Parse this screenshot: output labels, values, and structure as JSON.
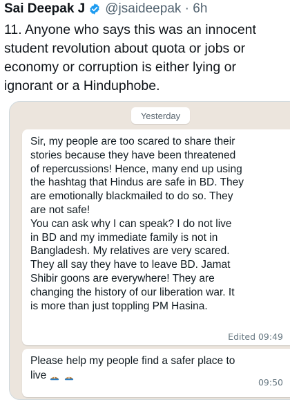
{
  "tweet": {
    "author_name": "Sai Deepak J",
    "handle_and_time": "@jsaideepak · 6h",
    "text_lines": [
      "11. Anyone who says this was an innocent",
      "student revolution about quota or jobs or",
      "economy or corruption is either lying or",
      "ignorant or a Hinduphobe."
    ]
  },
  "chat": {
    "date_chip": "Yesterday",
    "messages": [
      {
        "lines": [
          "Sir, my people are too scared to share their",
          "stories because they have been threatened",
          "of repercussions! Hence, many end up using",
          "the hashtag that Hindus are safe in BD. They",
          "are emotionally blackmailed to do so. They",
          "are not safe!",
          "You can ask why I can speak? I do not live",
          "in BD and my immediate family is not in",
          "Bangladesh. My relatives are very scared.",
          "They all say they have to leave BD. Jamat",
          "Shibir goons are everywhere! They are",
          "changing the history of our liberation war. It",
          "is more than just toppling PM Hasina."
        ],
        "meta": "Edited 09:49"
      },
      {
        "lines": [
          "Please help my people find a safer place to",
          "live"
        ],
        "meta": "09:50"
      }
    ]
  },
  "colors": {
    "verified_badge": "#1d9bf0",
    "chat_background": "#ece5dd",
    "bubble": "#ffffff",
    "meta_text": "#667781"
  },
  "icons": {
    "verified": "verified-badge-icon",
    "emoji": "folded-hands-icon"
  }
}
